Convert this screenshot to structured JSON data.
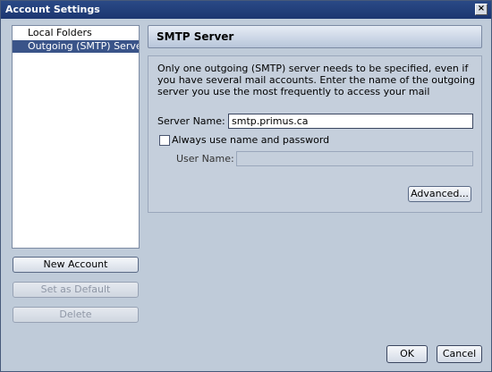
{
  "window": {
    "title": "Account Settings",
    "close_glyph": "×"
  },
  "accounts": [
    {
      "label": "Local Folders",
      "selected": false
    },
    {
      "label": "Outgoing (SMTP) Server",
      "selected": true
    }
  ],
  "side_buttons": {
    "new_account": "New Account",
    "set_default": "Set as Default",
    "delete": "Delete"
  },
  "panel": {
    "title": "SMTP Server",
    "description": "Only one outgoing (SMTP) server needs to be specified, even if you have several mail accounts. Enter the name of the outgoing server you use the most frequently to access your mail",
    "server_name_label": "Server Name:",
    "server_name_value": "smtp.primus.ca",
    "always_auth_label": "Always use name and password",
    "always_auth_checked": false,
    "user_name_label": "User Name:",
    "user_name_value": "",
    "advanced_label": "Advanced..."
  },
  "dialog_buttons": {
    "ok": "OK",
    "cancel": "Cancel"
  }
}
